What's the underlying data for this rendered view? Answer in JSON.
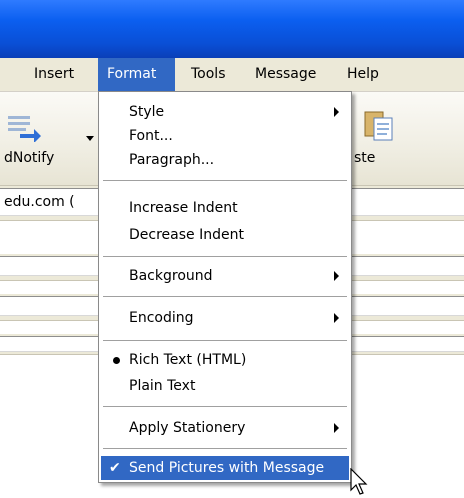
{
  "menubar": {
    "items": [
      {
        "label": "Insert"
      },
      {
        "label": "Format"
      },
      {
        "label": "Tools"
      },
      {
        "label": "Message"
      },
      {
        "label": "Help"
      }
    ]
  },
  "toolbar": {
    "left_label": "dNotify",
    "right_label": "ste"
  },
  "to_field": {
    "value": "edu.com  ("
  },
  "format_menu": {
    "style": "Style",
    "font": "Font...",
    "paragraph": "Paragraph...",
    "increase_indent": "Increase Indent",
    "decrease_indent": "Decrease Indent",
    "background": "Background",
    "encoding": "Encoding",
    "rich_text": "Rich Text (HTML)",
    "plain_text": "Plain Text",
    "apply_stationery": "Apply Stationery",
    "send_pictures": "Send Pictures with Message"
  },
  "colors": {
    "title_blue": "#0b5ff0",
    "menu_highlight": "#3168c4",
    "menu_bg": "#ece9d8"
  }
}
